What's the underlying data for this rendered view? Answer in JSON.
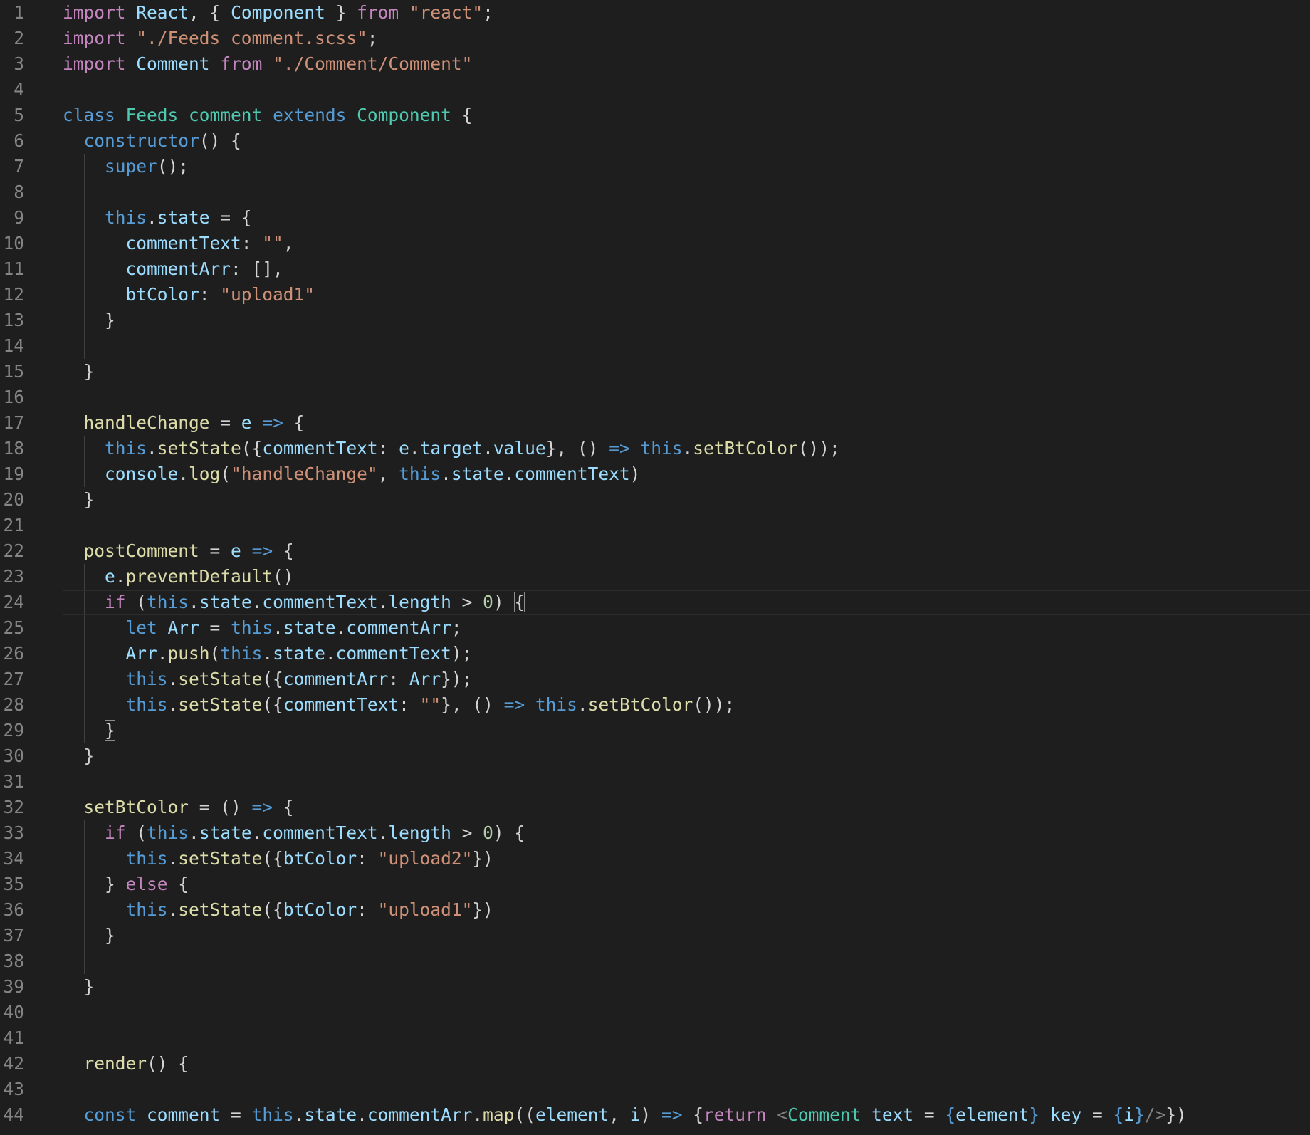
{
  "editor": {
    "theme": {
      "background": "#1e1e1e",
      "keyword": "#c586c0",
      "string": "#ce9178",
      "class": "#4ec9b0",
      "storage": "#569cd6",
      "variable": "#9cdcfe",
      "function": "#dcdcaa",
      "number": "#b5cea8",
      "punctuation": "#d4d4d4",
      "line_number": "#858585"
    },
    "current_line": 24,
    "lines": [
      {
        "n": "1",
        "indent": 0,
        "tokens": [
          [
            "kw",
            "import"
          ],
          [
            "pu",
            " "
          ],
          [
            "var",
            "React"
          ],
          [
            "pu",
            ", { "
          ],
          [
            "var",
            "Component"
          ],
          [
            "pu",
            " } "
          ],
          [
            "kw",
            "from"
          ],
          [
            "pu",
            " "
          ],
          [
            "st",
            "\"react\""
          ],
          [
            "pu",
            ";"
          ]
        ]
      },
      {
        "n": "2",
        "indent": 0,
        "tokens": [
          [
            "kw",
            "import"
          ],
          [
            "pu",
            " "
          ],
          [
            "st",
            "\"./Feeds_comment.scss\""
          ],
          [
            "pu",
            ";"
          ]
        ]
      },
      {
        "n": "3",
        "indent": 0,
        "tokens": [
          [
            "kw",
            "import"
          ],
          [
            "pu",
            " "
          ],
          [
            "var",
            "Comment"
          ],
          [
            "pu",
            " "
          ],
          [
            "kw",
            "from"
          ],
          [
            "pu",
            " "
          ],
          [
            "st",
            "\"./Comment/Comment\""
          ]
        ]
      },
      {
        "n": "4",
        "indent": 0,
        "tokens": []
      },
      {
        "n": "5",
        "indent": 0,
        "tokens": [
          [
            "sk",
            "class"
          ],
          [
            "pu",
            " "
          ],
          [
            "cl",
            "Feeds_comment"
          ],
          [
            "pu",
            " "
          ],
          [
            "sk",
            "extends"
          ],
          [
            "pu",
            " "
          ],
          [
            "cl",
            "Component"
          ],
          [
            "pu",
            " {"
          ]
        ]
      },
      {
        "n": "6",
        "indent": 1,
        "tokens": [
          [
            "sk",
            "constructor"
          ],
          [
            "pu",
            "() {"
          ]
        ]
      },
      {
        "n": "7",
        "indent": 2,
        "tokens": [
          [
            "sk",
            "super"
          ],
          [
            "pu",
            "();"
          ]
        ]
      },
      {
        "n": "8",
        "indent": 2,
        "tokens": []
      },
      {
        "n": "9",
        "indent": 2,
        "tokens": [
          [
            "sk",
            "this"
          ],
          [
            "pu",
            "."
          ],
          [
            "var",
            "state"
          ],
          [
            "pu",
            " = {"
          ]
        ]
      },
      {
        "n": "10",
        "indent": 3,
        "tokens": [
          [
            "var",
            "commentText"
          ],
          [
            "pu",
            ": "
          ],
          [
            "st",
            "\"\""
          ],
          [
            "pu",
            ","
          ]
        ]
      },
      {
        "n": "11",
        "indent": 3,
        "tokens": [
          [
            "var",
            "commentArr"
          ],
          [
            "pu",
            ": [],"
          ]
        ]
      },
      {
        "n": "12",
        "indent": 3,
        "tokens": [
          [
            "var",
            "btColor"
          ],
          [
            "pu",
            ": "
          ],
          [
            "st",
            "\"upload1\""
          ]
        ]
      },
      {
        "n": "13",
        "indent": 2,
        "tokens": [
          [
            "pu",
            "}"
          ]
        ]
      },
      {
        "n": "14",
        "indent": 2,
        "tokens": []
      },
      {
        "n": "15",
        "indent": 1,
        "tokens": [
          [
            "pu",
            "}"
          ]
        ]
      },
      {
        "n": "16",
        "indent": 1,
        "tokens": []
      },
      {
        "n": "17",
        "indent": 1,
        "tokens": [
          [
            "fn",
            "handleChange"
          ],
          [
            "pu",
            " = "
          ],
          [
            "var",
            "e"
          ],
          [
            "pu",
            " "
          ],
          [
            "sk",
            "=>"
          ],
          [
            "pu",
            " {"
          ]
        ]
      },
      {
        "n": "18",
        "indent": 2,
        "tokens": [
          [
            "sk",
            "this"
          ],
          [
            "pu",
            "."
          ],
          [
            "fn",
            "setState"
          ],
          [
            "pu",
            "({"
          ],
          [
            "var",
            "commentText"
          ],
          [
            "pu",
            ": "
          ],
          [
            "var",
            "e"
          ],
          [
            "pu",
            "."
          ],
          [
            "var",
            "target"
          ],
          [
            "pu",
            "."
          ],
          [
            "var",
            "value"
          ],
          [
            "pu",
            "}, () "
          ],
          [
            "sk",
            "=>"
          ],
          [
            "pu",
            " "
          ],
          [
            "sk",
            "this"
          ],
          [
            "pu",
            "."
          ],
          [
            "fn",
            "setBtColor"
          ],
          [
            "pu",
            "());"
          ]
        ]
      },
      {
        "n": "19",
        "indent": 2,
        "tokens": [
          [
            "var",
            "console"
          ],
          [
            "pu",
            "."
          ],
          [
            "fn",
            "log"
          ],
          [
            "pu",
            "("
          ],
          [
            "st",
            "\"handleChange\""
          ],
          [
            "pu",
            ", "
          ],
          [
            "sk",
            "this"
          ],
          [
            "pu",
            "."
          ],
          [
            "var",
            "state"
          ],
          [
            "pu",
            "."
          ],
          [
            "var",
            "commentText"
          ],
          [
            "pu",
            ")"
          ]
        ]
      },
      {
        "n": "20",
        "indent": 1,
        "tokens": [
          [
            "pu",
            "}"
          ]
        ]
      },
      {
        "n": "21",
        "indent": 1,
        "tokens": []
      },
      {
        "n": "22",
        "indent": 1,
        "tokens": [
          [
            "fn",
            "postComment"
          ],
          [
            "pu",
            " = "
          ],
          [
            "var",
            "e"
          ],
          [
            "pu",
            " "
          ],
          [
            "sk",
            "=>"
          ],
          [
            "pu",
            " {"
          ]
        ]
      },
      {
        "n": "23",
        "indent": 2,
        "tokens": [
          [
            "var",
            "e"
          ],
          [
            "pu",
            "."
          ],
          [
            "fn",
            "preventDefault"
          ],
          [
            "pu",
            "()"
          ]
        ]
      },
      {
        "n": "24",
        "indent": 2,
        "tokens": [
          [
            "kw",
            "if"
          ],
          [
            "pu",
            " ("
          ],
          [
            "sk",
            "this"
          ],
          [
            "pu",
            "."
          ],
          [
            "var",
            "state"
          ],
          [
            "pu",
            "."
          ],
          [
            "var",
            "commentText"
          ],
          [
            "pu",
            "."
          ],
          [
            "var",
            "length"
          ],
          [
            "pu",
            " > "
          ],
          [
            "nu",
            "0"
          ],
          [
            "pu",
            ") "
          ],
          [
            "br",
            "{"
          ]
        ]
      },
      {
        "n": "25",
        "indent": 3,
        "tokens": [
          [
            "sk",
            "let"
          ],
          [
            "pu",
            " "
          ],
          [
            "var",
            "Arr"
          ],
          [
            "pu",
            " = "
          ],
          [
            "sk",
            "this"
          ],
          [
            "pu",
            "."
          ],
          [
            "var",
            "state"
          ],
          [
            "pu",
            "."
          ],
          [
            "var",
            "commentArr"
          ],
          [
            "pu",
            ";"
          ]
        ]
      },
      {
        "n": "26",
        "indent": 3,
        "tokens": [
          [
            "var",
            "Arr"
          ],
          [
            "pu",
            "."
          ],
          [
            "fn",
            "push"
          ],
          [
            "pu",
            "("
          ],
          [
            "sk",
            "this"
          ],
          [
            "pu",
            "."
          ],
          [
            "var",
            "state"
          ],
          [
            "pu",
            "."
          ],
          [
            "var",
            "commentText"
          ],
          [
            "pu",
            ");"
          ]
        ]
      },
      {
        "n": "27",
        "indent": 3,
        "tokens": [
          [
            "sk",
            "this"
          ],
          [
            "pu",
            "."
          ],
          [
            "fn",
            "setState"
          ],
          [
            "pu",
            "({"
          ],
          [
            "var",
            "commentArr"
          ],
          [
            "pu",
            ": "
          ],
          [
            "var",
            "Arr"
          ],
          [
            "pu",
            "});"
          ]
        ]
      },
      {
        "n": "28",
        "indent": 3,
        "tokens": [
          [
            "sk",
            "this"
          ],
          [
            "pu",
            "."
          ],
          [
            "fn",
            "setState"
          ],
          [
            "pu",
            "({"
          ],
          [
            "var",
            "commentText"
          ],
          [
            "pu",
            ": "
          ],
          [
            "st",
            "\"\""
          ],
          [
            "pu",
            "}, () "
          ],
          [
            "sk",
            "=>"
          ],
          [
            "pu",
            " "
          ],
          [
            "sk",
            "this"
          ],
          [
            "pu",
            "."
          ],
          [
            "fn",
            "setBtColor"
          ],
          [
            "pu",
            "());"
          ]
        ]
      },
      {
        "n": "29",
        "indent": 2,
        "tokens": [
          [
            "br",
            "}"
          ]
        ]
      },
      {
        "n": "30",
        "indent": 1,
        "tokens": [
          [
            "pu",
            "}"
          ]
        ]
      },
      {
        "n": "31",
        "indent": 1,
        "tokens": []
      },
      {
        "n": "32",
        "indent": 1,
        "tokens": [
          [
            "fn",
            "setBtColor"
          ],
          [
            "pu",
            " = () "
          ],
          [
            "sk",
            "=>"
          ],
          [
            "pu",
            " {"
          ]
        ]
      },
      {
        "n": "33",
        "indent": 2,
        "tokens": [
          [
            "kw",
            "if"
          ],
          [
            "pu",
            " ("
          ],
          [
            "sk",
            "this"
          ],
          [
            "pu",
            "."
          ],
          [
            "var",
            "state"
          ],
          [
            "pu",
            "."
          ],
          [
            "var",
            "commentText"
          ],
          [
            "pu",
            "."
          ],
          [
            "var",
            "length"
          ],
          [
            "pu",
            " > "
          ],
          [
            "nu",
            "0"
          ],
          [
            "pu",
            ") {"
          ]
        ]
      },
      {
        "n": "34",
        "indent": 3,
        "tokens": [
          [
            "sk",
            "this"
          ],
          [
            "pu",
            "."
          ],
          [
            "fn",
            "setState"
          ],
          [
            "pu",
            "({"
          ],
          [
            "var",
            "btColor"
          ],
          [
            "pu",
            ": "
          ],
          [
            "st",
            "\"upload2\""
          ],
          [
            "pu",
            "})"
          ]
        ]
      },
      {
        "n": "35",
        "indent": 2,
        "tokens": [
          [
            "pu",
            "} "
          ],
          [
            "kw",
            "else"
          ],
          [
            "pu",
            " {"
          ]
        ]
      },
      {
        "n": "36",
        "indent": 3,
        "tokens": [
          [
            "sk",
            "this"
          ],
          [
            "pu",
            "."
          ],
          [
            "fn",
            "setState"
          ],
          [
            "pu",
            "({"
          ],
          [
            "var",
            "btColor"
          ],
          [
            "pu",
            ": "
          ],
          [
            "st",
            "\"upload1\""
          ],
          [
            "pu",
            "})"
          ]
        ]
      },
      {
        "n": "37",
        "indent": 2,
        "tokens": [
          [
            "pu",
            "}"
          ]
        ]
      },
      {
        "n": "38",
        "indent": 2,
        "tokens": []
      },
      {
        "n": "39",
        "indent": 1,
        "tokens": [
          [
            "pu",
            "}"
          ]
        ]
      },
      {
        "n": "40",
        "indent": 1,
        "tokens": []
      },
      {
        "n": "41",
        "indent": 1,
        "tokens": []
      },
      {
        "n": "42",
        "indent": 1,
        "tokens": [
          [
            "fn",
            "render"
          ],
          [
            "pu",
            "() {"
          ]
        ]
      },
      {
        "n": "43",
        "indent": 1,
        "tokens": []
      },
      {
        "n": "44",
        "indent": 1,
        "tokens": [
          [
            "sk",
            "const"
          ],
          [
            "pu",
            " "
          ],
          [
            "var",
            "comment"
          ],
          [
            "pu",
            " = "
          ],
          [
            "sk",
            "this"
          ],
          [
            "pu",
            "."
          ],
          [
            "var",
            "state"
          ],
          [
            "pu",
            "."
          ],
          [
            "var",
            "commentArr"
          ],
          [
            "pu",
            "."
          ],
          [
            "fn",
            "map"
          ],
          [
            "pu",
            "(("
          ],
          [
            "var",
            "element"
          ],
          [
            "pu",
            ", "
          ],
          [
            "var",
            "i"
          ],
          [
            "pu",
            ") "
          ],
          [
            "sk",
            "=>"
          ],
          [
            "pu",
            " {"
          ],
          [
            "kw",
            "return"
          ],
          [
            "pu",
            " "
          ],
          [
            "tag",
            "<"
          ],
          [
            "cl",
            "Comment"
          ],
          [
            "pu",
            " "
          ],
          [
            "var",
            "text"
          ],
          [
            "pu",
            " = "
          ],
          [
            "sk",
            "{"
          ],
          [
            "var",
            "element"
          ],
          [
            "sk",
            "}"
          ],
          [
            "pu",
            " "
          ],
          [
            "var",
            "key"
          ],
          [
            "pu",
            " = "
          ],
          [
            "sk",
            "{"
          ],
          [
            "var",
            "i"
          ],
          [
            "sk",
            "}"
          ],
          [
            "tag",
            "/>"
          ],
          [
            "pu",
            "})"
          ]
        ]
      }
    ]
  }
}
